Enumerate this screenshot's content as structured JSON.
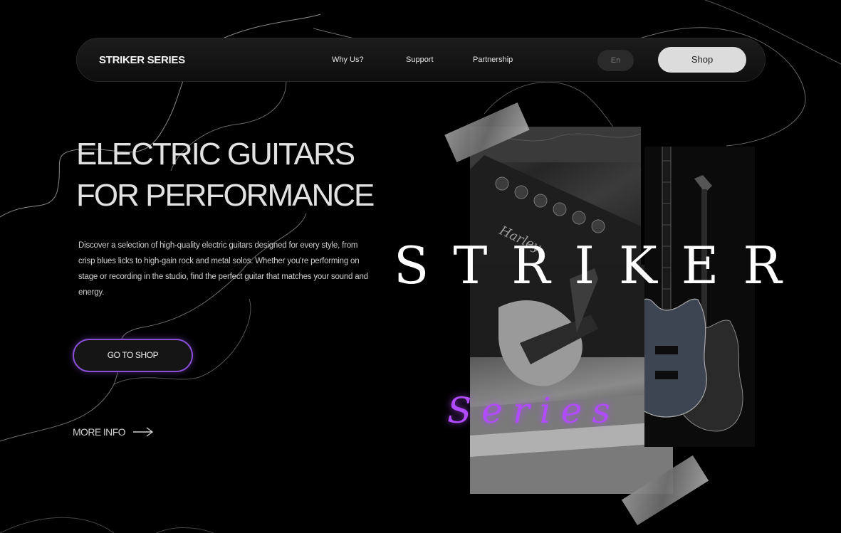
{
  "nav": {
    "brand": "STRIKER SERIES",
    "links": [
      "Why Us?",
      "Support",
      "Partnership"
    ],
    "lang": "En",
    "shop": "Shop"
  },
  "hero": {
    "headline_line1": "ELECTRIC GUITARS",
    "headline_line2": "FOR PERFORMANCE",
    "description": "Discover a selection of high-quality electric guitars designed for every style, from crisp blues licks to high-gain rock and metal solos. Whether you're performing on stage or recording in the studio, find the perfect guitar that matches your sound and energy.",
    "cta": "GO TO SHOP",
    "more": "MORE INFO",
    "more_icon": "arrow-right-icon"
  },
  "collage": {
    "title_word": "STRIKER",
    "script_word": "Series",
    "amp_brand": "Harley"
  },
  "colors": {
    "accent": "#8a4fd8",
    "script": "#b04bff",
    "background": "#000000"
  }
}
